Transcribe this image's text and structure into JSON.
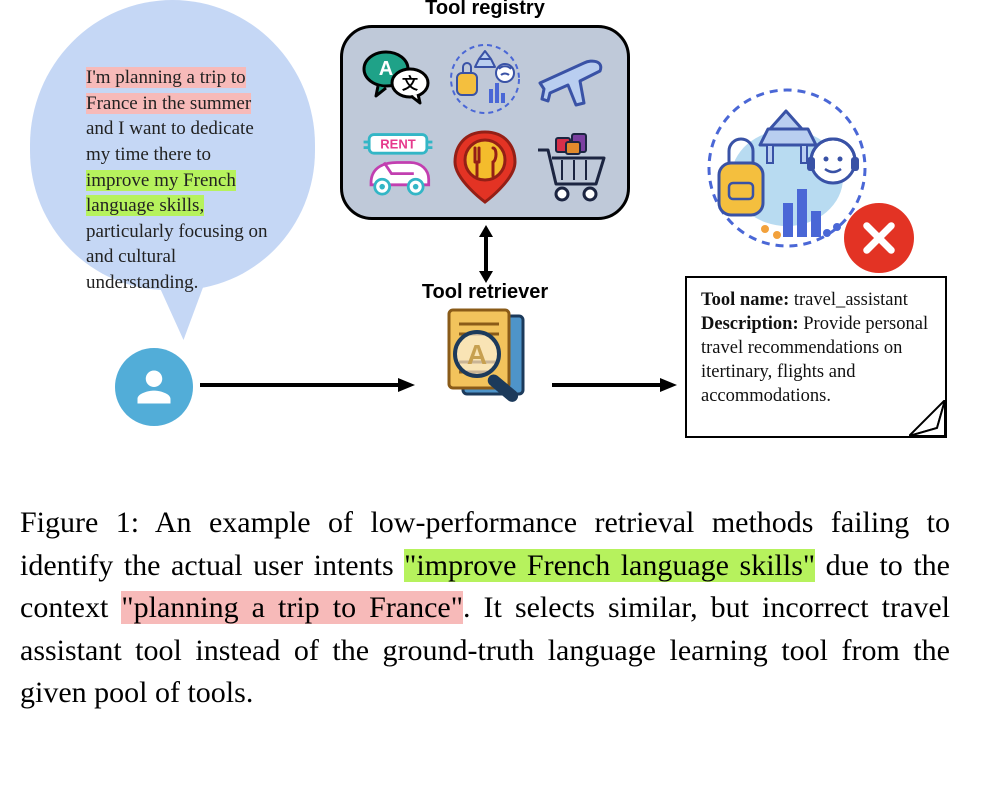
{
  "query": {
    "line1_pink": "I'm planning a trip to",
    "line2_pink": "France in the summer",
    "line3": "and I want to dedicate",
    "line4": "my time there to",
    "line5_green_a": "improve my French",
    "line6_green_a": "language skills,",
    "line7": "particularly focusing on",
    "line8": "and cultural",
    "line9": "understanding."
  },
  "labels": {
    "registry": "Tool registry",
    "retriever": "Tool retriever"
  },
  "tool_card": {
    "name_label": "Tool name:",
    "name_value": "travel_assistant",
    "desc_label": "Description:",
    "desc_value": "Provide personal travel recommendations on itertinary, flights and accommodations."
  },
  "caption": {
    "prefix": "Figure 1:  An example of low-performance retrieval methods failing to identify the actual user intents ",
    "hl1": "\"improve French language skills\"",
    "mid": " due to the context ",
    "hl2": "\"planning a trip to France\"",
    "suffix": ".  It selects similar, but incorrect travel assistant tool instead of the ground-truth language learning tool from the given pool of tools."
  }
}
